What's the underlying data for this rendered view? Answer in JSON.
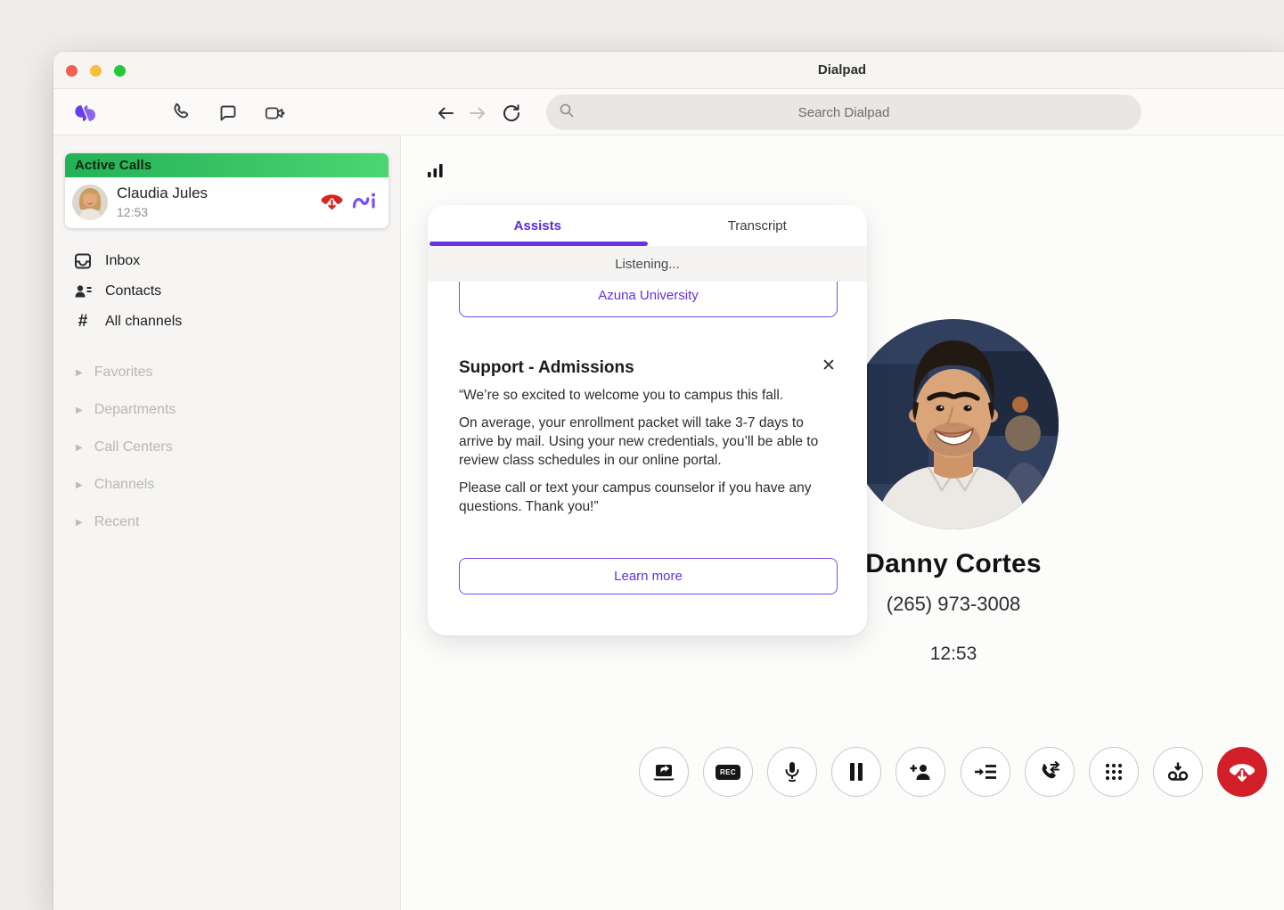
{
  "window": {
    "title": "Dialpad"
  },
  "search": {
    "placeholder": "Search Dialpad"
  },
  "active_calls": {
    "header": "Active Calls",
    "caller": "Claudia Jules",
    "time": "12:53"
  },
  "sidebar": {
    "nav": [
      "Inbox",
      "Contacts",
      "All channels"
    ],
    "sections": [
      "Favorites",
      "Departments",
      "Call Centers",
      "Channels",
      "Recent"
    ]
  },
  "assist": {
    "tab_assists": "Assists",
    "tab_transcript": "Transcript",
    "status": "Listening...",
    "suggestion": "Azuna University",
    "title": "Support - Admissions",
    "p": [
      "“We’re so excited to welcome you to campus this fall.",
      "On average, your enrollment packet will take 3-7 days to arrive by mail. Using your new credentials, you’ll be able to review class schedules in our online portal.",
      "Please call or text your campus counselor if you have any questions. Thank you!”"
    ],
    "learn_more": "Learn more"
  },
  "call": {
    "name": "Danny Cortes",
    "phone": "(265) 973-3008",
    "timer": "12:53"
  },
  "controls": {
    "rec": "REC",
    "items": [
      "screen-share",
      "record",
      "mute",
      "hold",
      "add-participant",
      "add-to-queue",
      "transfer-call",
      "show-dialpad",
      "voicemail-drop",
      "end-call"
    ]
  },
  "colors": {
    "accent_purple": "#6231e4",
    "logo_purple": "#7a52f4",
    "active_green_start": "#23b156",
    "active_green_end": "#4cd572",
    "danger_red": "#d32028"
  }
}
